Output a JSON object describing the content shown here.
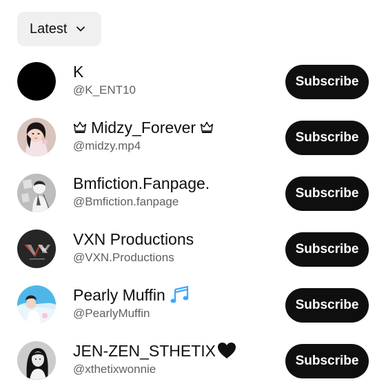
{
  "sort": {
    "label": "Latest",
    "icon": "chevron-down-icon"
  },
  "channels": [
    {
      "name": "K",
      "handle": "@K_ENT10",
      "button": "Subscribe",
      "avatar": "black-circle"
    },
    {
      "name": "Midzy_Forever",
      "name_prefix_icon": "crown-icon",
      "name_suffix_icon": "crown-icon",
      "handle": "@midzy.mp4",
      "button": "Subscribe",
      "avatar": "photo-woman"
    },
    {
      "name": "Bmfiction.Fanpage.",
      "handle": "@Bmfiction.fanpage",
      "button": "Subscribe",
      "avatar": "photo-sketch"
    },
    {
      "name": "VXN Productions",
      "handle": "@VXN.Productions",
      "button": "Subscribe",
      "avatar": "vxn-logo"
    },
    {
      "name": "Pearly Muffin",
      "name_suffix_icon": "music-notes-icon",
      "handle": "@PearlyMuffin",
      "button": "Subscribe",
      "avatar": "photo-blue"
    },
    {
      "name": "JEN-ZEN_STHETIX",
      "name_suffix_icon": "black-heart-icon",
      "handle": "@xthetixwonnie",
      "button": "Subscribe",
      "avatar": "photo-bw"
    }
  ],
  "colors": {
    "button_bg": "#0f0f0f",
    "button_text": "#ffffff",
    "chip_bg": "#f0f0f0",
    "handle_text": "#606060",
    "music_notes": "#3ea6ff"
  }
}
